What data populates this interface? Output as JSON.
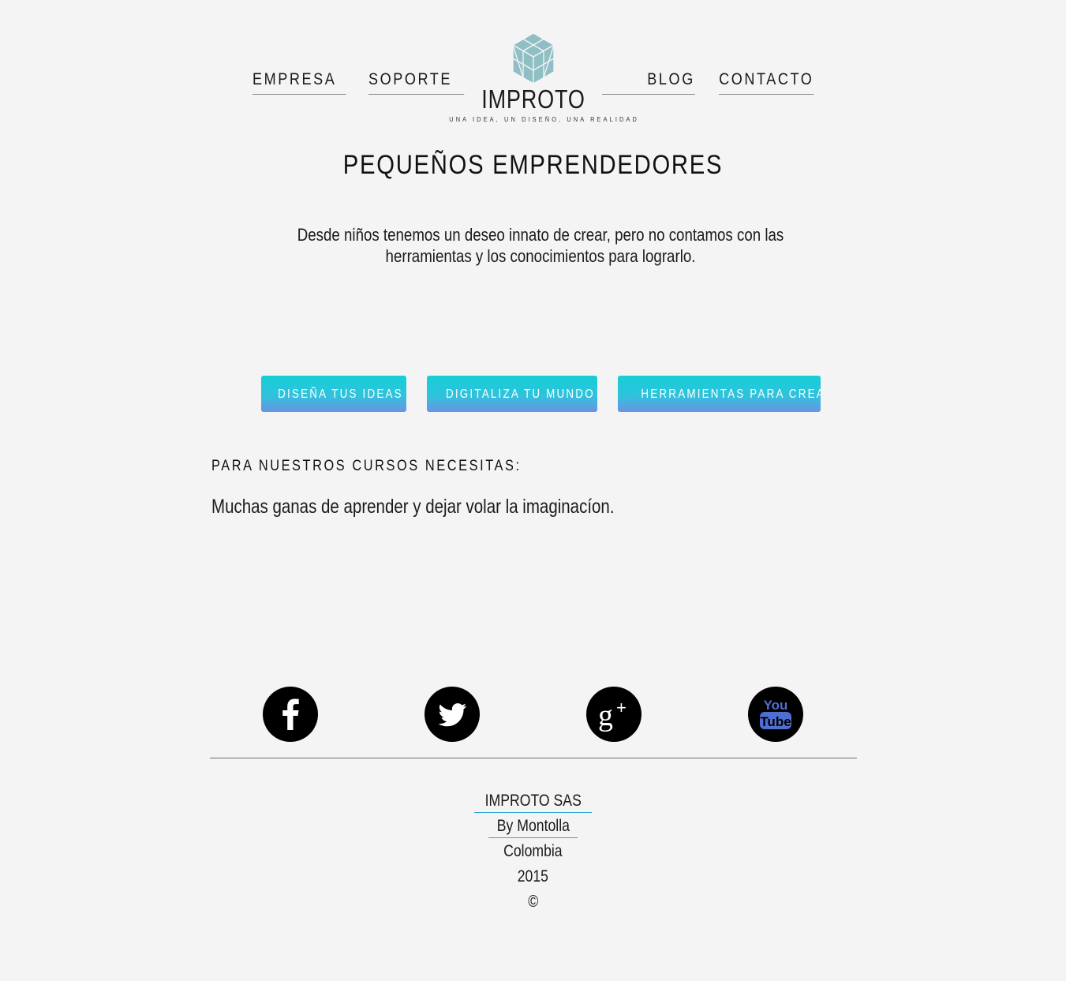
{
  "nav": {
    "empresa": "EMPRESA",
    "soporte": "SOPORTE",
    "blog": "BLOG",
    "contacto": "CONTACTO"
  },
  "logo": {
    "name": "IMPROTO",
    "tagline": "UNA IDEA, UN DISEÑO, UNA REALIDAD",
    "color": "#8fbfc4"
  },
  "main": {
    "title": "PEQUEÑOS EMPRENDEDORES",
    "intro": "Desde niños tenemos un deseo innato de crear, pero no contamos con las herramientas y los conocimientos para lograrlo.",
    "buttons": [
      {
        "label": "DISEÑA TUS IDEAS"
      },
      {
        "label": "DIGITALIZA TU MUNDO"
      },
      {
        "label": "HERRAMIENTAS PARA CREAR"
      }
    ],
    "requirements_heading": "PARA NUESTROS CURSOS NECESITAS:",
    "requirements_text": "Muchas ganas de aprender y dejar volar la imaginacíon."
  },
  "social": [
    {
      "icon": "facebook-icon"
    },
    {
      "icon": "twitter-icon"
    },
    {
      "icon": "google-plus-icon"
    },
    {
      "icon": "youtube-icon"
    }
  ],
  "footer": {
    "company": "IMPROTO SAS",
    "author": "By Montolla",
    "country": "Colombia",
    "year": "2015",
    "copyright": "©"
  },
  "colors": {
    "background": "#f4f4f4",
    "button_top": "#14cfd6",
    "button_bottom": "#6b92e4",
    "link_underline": "#2fa8d8",
    "youtube_blue": "#4f6fd1"
  }
}
